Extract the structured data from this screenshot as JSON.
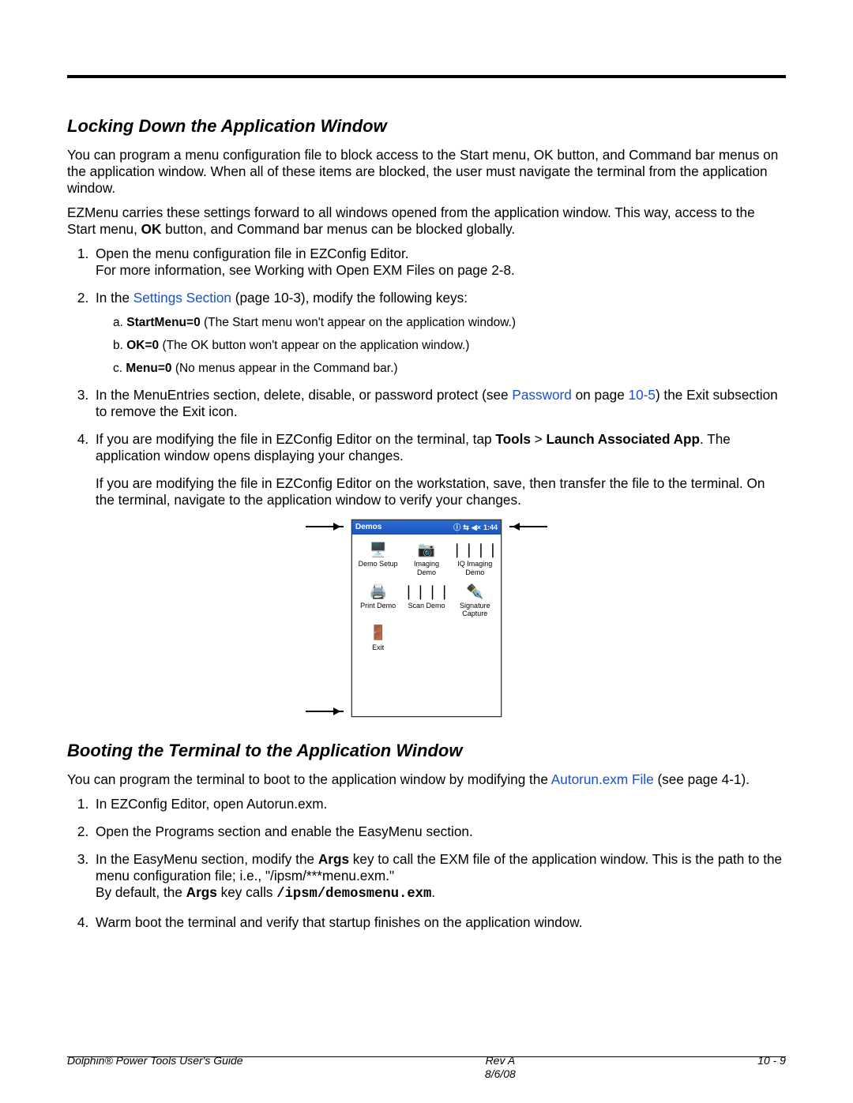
{
  "section1": {
    "heading": "Locking Down the Application Window",
    "para1": "You can program a menu configuration file to block access to the Start menu, OK button, and Command bar menus on the application window. When all of these items are blocked, the user must navigate the terminal from the application window.",
    "para2a": "EZMenu carries these settings forward to all windows opened from the application window. This way, access to the Start menu, ",
    "para2_ok": "OK",
    "para2b": " button, and Command bar menus can be blocked globally.",
    "step1a": "Open the menu configuration file in EZConfig Editor.",
    "step1b": "For more information, see Working with Open EXM Files on page 2-8.",
    "step2a": "In the ",
    "step2_link": "Settings Section",
    "step2b": " (page 10-3), modify the following keys:",
    "sub_a_prefix": "a. ",
    "sub_a_bold": "StartMenu=0",
    "sub_a_rest": "  (The Start menu won't appear on the application window.)",
    "sub_b_prefix": "b. ",
    "sub_b_bold": "OK=0",
    "sub_b_rest": "  (The OK button won't appear on the application window.)",
    "sub_c_prefix": "c. ",
    "sub_c_bold": "Menu=0",
    "sub_c_rest": "  (No menus appear in the Command bar.)",
    "step3a": "In the MenuEntries section, delete, disable, or password protect (see ",
    "step3_link1": "Password",
    "step3b": " on page ",
    "step3_link2": "10-5",
    "step3c": ") the Exit subsection to remove the Exit icon.",
    "step4a": "If you are modifying the file in EZConfig Editor on the terminal, tap ",
    "step4_bold1": "Tools",
    "step4_gt": " > ",
    "step4_bold2": "Launch Associated App",
    "step4b": ". The application window opens displaying your changes.",
    "step4_p2": "If you are modifying the file in EZConfig Editor on the workstation, save, then transfer the file to the terminal. On the terminal, navigate to the application window to verify your changes."
  },
  "device": {
    "title": "Demos",
    "time": "1:44",
    "apps": [
      {
        "label": "Demo Setup",
        "icon": "🖥️"
      },
      {
        "label": "Imaging Demo",
        "icon": "📷"
      },
      {
        "label": "IQ Imaging Demo",
        "icon": "❘❘❘❘"
      },
      {
        "label": "Print Demo",
        "icon": "🖨️"
      },
      {
        "label": "Scan Demo",
        "icon": "❘❘❘❘"
      },
      {
        "label": "Signature Capture",
        "icon": "✒️"
      },
      {
        "label": "Exit",
        "icon": "🚪"
      }
    ]
  },
  "section2": {
    "heading": "Booting the Terminal to the Application Window",
    "para1a": "You can program the terminal to boot to the application window by modifying the ",
    "para1_link": "Autorun.exm File",
    "para1b": " (see page 4-1).",
    "step1": "In EZConfig Editor, open Autorun.exm.",
    "step2": "Open the Programs section and enable the EasyMenu section.",
    "step3a": "In the EasyMenu section, modify the ",
    "step3_bold1": "Args",
    "step3b": " key to call the EXM file of the application window. This is the path to the menu configuration file; i.e., \"/ipsm/***menu.exm.\"",
    "step3c": "By default, the ",
    "step3_bold2": "Args",
    "step3d": " key calls ",
    "step3_mono": "/ipsm/demosmenu.exm",
    "step3e": ".",
    "step4": "Warm boot the terminal and verify that startup finishes on the application window."
  },
  "footer": {
    "left": "Dolphin® Power Tools User's Guide",
    "center1": "Rev A",
    "center2": "8/6/08",
    "right": "10 - 9"
  }
}
